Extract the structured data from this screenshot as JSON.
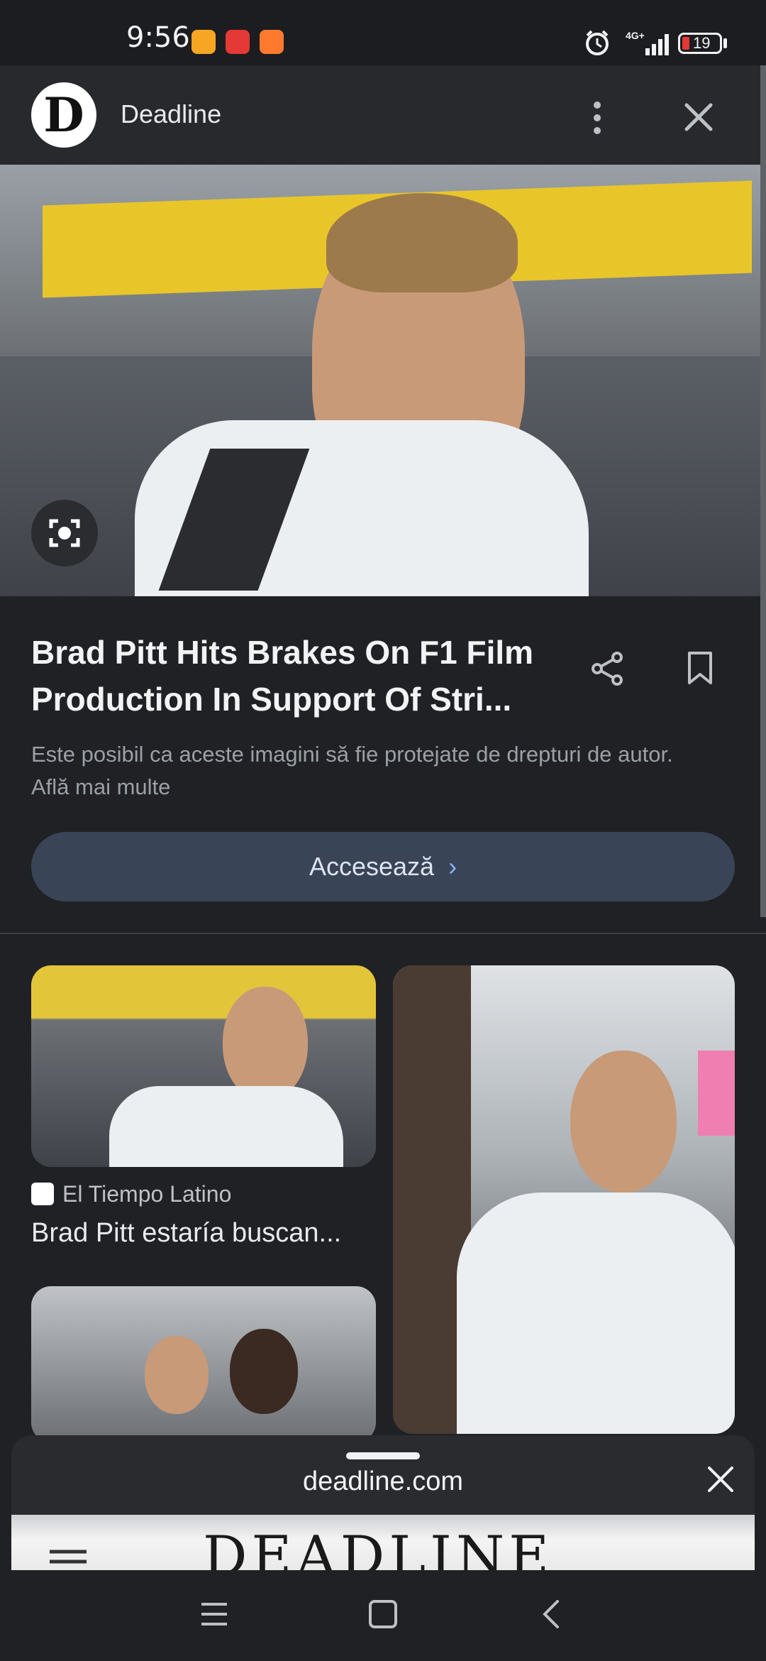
{
  "status_bar": {
    "time": "9:56",
    "battery": "19",
    "network": "4G+"
  },
  "header": {
    "logo_letter": "D",
    "site_name": "Deadline"
  },
  "article": {
    "title": "Brad Pitt Hits Brakes On F1 Film Production In Support Of Stri...",
    "copyright_notice": "Este posibil ca aceste imagini să fie protejate de drepturi de autor. Află mai multe",
    "visit_button": "Accesează"
  },
  "related": [
    {
      "source": "El Tiempo Latino",
      "caption": "Brad Pitt estaría buscan..."
    }
  ],
  "sheet": {
    "domain": "deadline.com",
    "masthead": "DEADLINE"
  },
  "colors": {
    "background": "#202124",
    "visit_button_bg": "#394457",
    "accent_chevron": "#8ab4f8"
  }
}
